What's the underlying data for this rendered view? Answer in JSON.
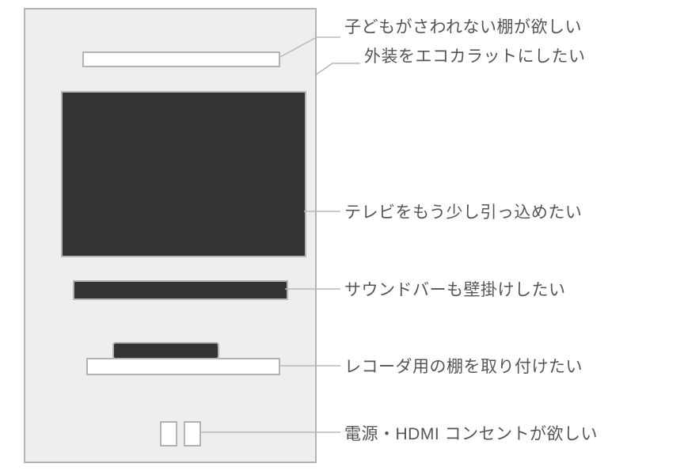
{
  "labels": {
    "shelf": "子どもがさわれない棚が欲しい",
    "ecocarat": "外装をエコカラットにしたい",
    "tv": "テレビをもう少し引っ込めたい",
    "soundbar": "サウンドバーも壁掛けしたい",
    "recorder": "レコーダ用の棚を取り付けたい",
    "outlet": "電源・HDMI コンセントが欲しい"
  }
}
